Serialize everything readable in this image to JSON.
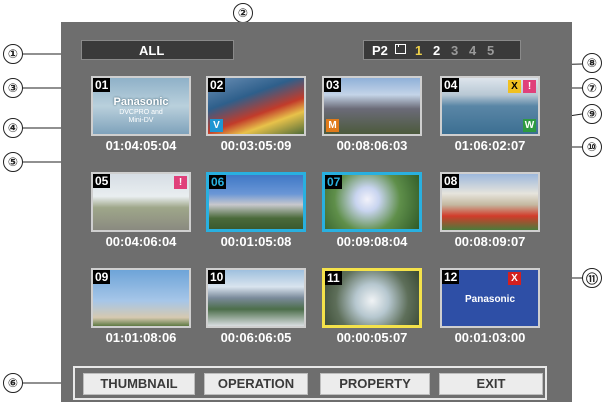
{
  "header": {
    "filter_label": "ALL",
    "card_label": "P2",
    "card_icon": "memory-card-icon",
    "slots": [
      "1",
      "2",
      "3",
      "4",
      "5"
    ],
    "active_slot": "2"
  },
  "clips": [
    {
      "num": "01",
      "timecode": "01:04:05:04",
      "scene_title": "Panasonic",
      "scene_sub1": "DVCPRO and",
      "scene_sub2": "Mini-DV"
    },
    {
      "num": "02",
      "timecode": "00:03:05:09",
      "badge": "V"
    },
    {
      "num": "03",
      "timecode": "00:08:06:03",
      "badge": "M"
    },
    {
      "num": "04",
      "timecode": "01:06:02:07",
      "badge_x": "X",
      "badge_excl": "!",
      "badge_w": "W"
    },
    {
      "num": "05",
      "timecode": "00:04:06:04",
      "badge": "!"
    },
    {
      "num": "06",
      "timecode": "00:01:05:08"
    },
    {
      "num": "07",
      "timecode": "00:09:08:04"
    },
    {
      "num": "08",
      "timecode": "00:08:09:07"
    },
    {
      "num": "09",
      "timecode": "01:01:08:06"
    },
    {
      "num": "10",
      "timecode": "00:06:06:05"
    },
    {
      "num": "11",
      "timecode": "00:00:05:07"
    },
    {
      "num": "12",
      "timecode": "00:01:03:00",
      "badge": "X",
      "scene_title": "Panasonic"
    }
  ],
  "buttons": {
    "thumbnail": "THUMBNAIL",
    "operation": "OPERATION",
    "property": "PROPERTY",
    "exit": "EXIT"
  },
  "callouts": [
    "①",
    "②",
    "③",
    "④",
    "⑤",
    "⑥",
    "⑦",
    "⑧",
    "⑨",
    "⑩",
    "⑪"
  ],
  "colors": {
    "screen": "#6e6e6e",
    "selected_cyan": "#29b0e0",
    "selected_yellow": "#f4e24a",
    "badge_v": "#1e96d2",
    "badge_m": "#e07a1a",
    "badge_x": "#f0c020",
    "badge_excl": "#e0407a",
    "badge_w": "#2e9a40",
    "badge_err": "#d42020"
  }
}
